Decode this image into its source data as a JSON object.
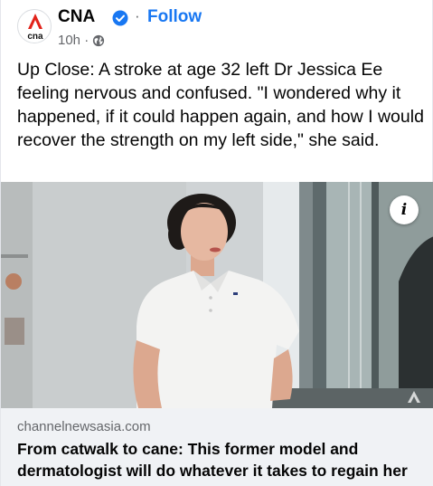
{
  "post": {
    "page_name": "CNA",
    "separator": "·",
    "follow_label": "Follow",
    "time": "10h ·",
    "avatar_text": "cna",
    "text": "Up Close: A stroke at age 32 left Dr Jessica Ee feeling nervous and confused. \"I wondered why it happened, if it could happen again, and how I would recover the strength on my left side,\" she said.",
    "info_icon_glyph": "i"
  },
  "link_preview": {
    "domain": "channelnewsasia.com",
    "title": "From catwalk to cane: This former model and dermatologist will do whatever it takes to regain her ..."
  },
  "icons": {
    "verified": "verified-badge-icon",
    "privacy": "globe-icon",
    "info": "info-icon",
    "watermark": "cna-watermark-icon"
  },
  "colors": {
    "accent": "#1877f2",
    "brand_red": "#e2231a",
    "link_bg": "#f0f2f5",
    "secondary_text": "#65676b"
  }
}
